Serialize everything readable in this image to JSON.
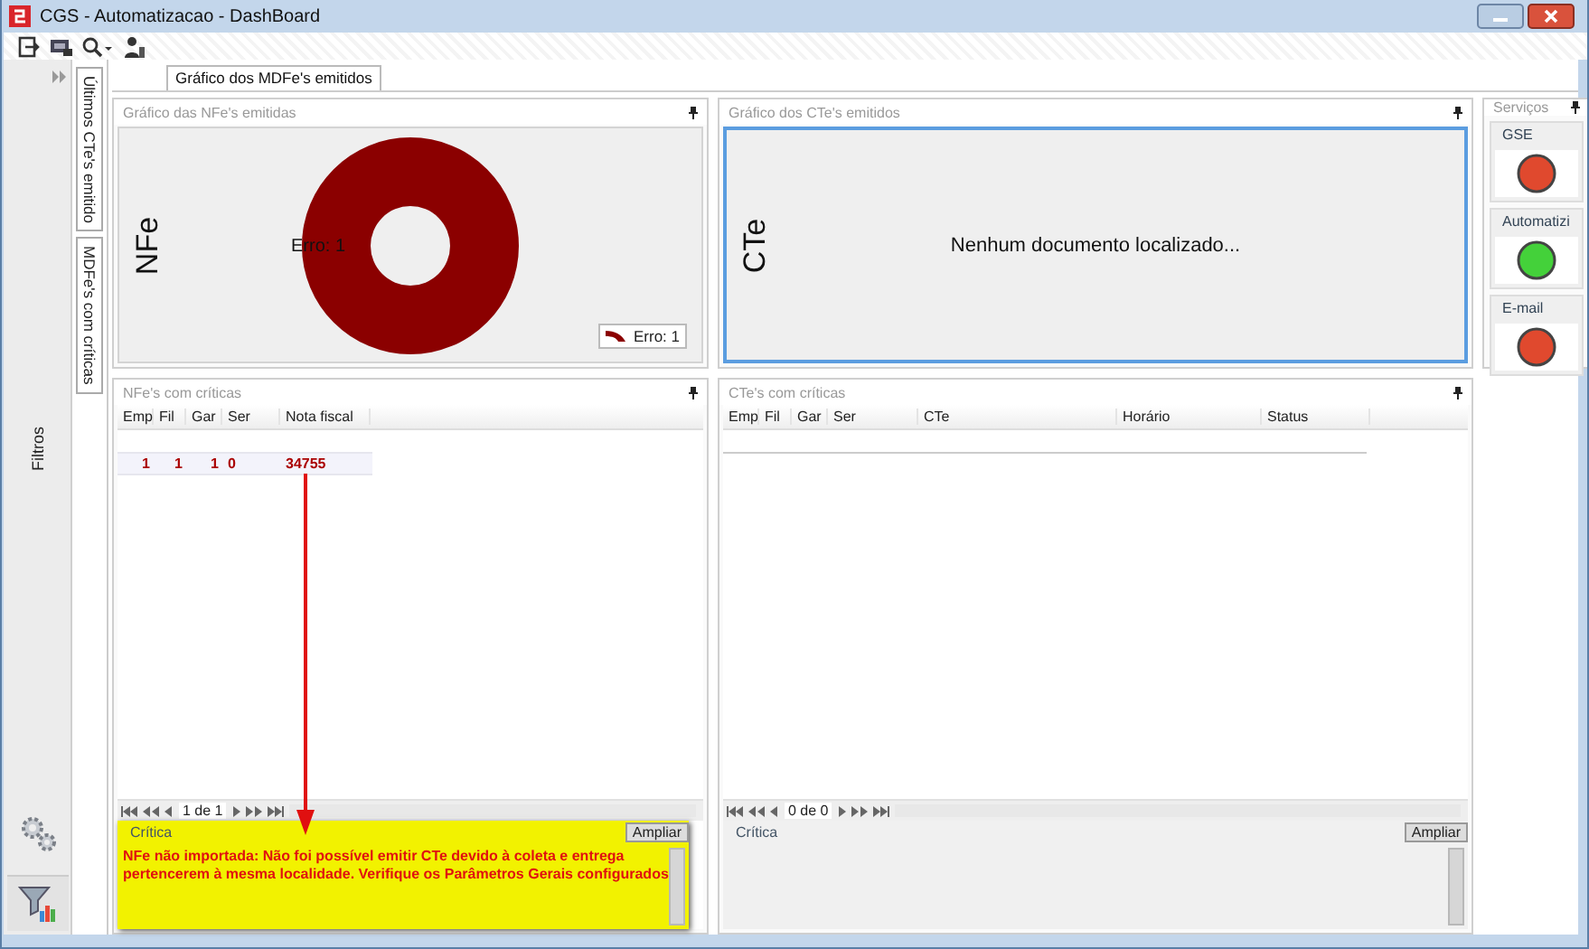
{
  "window": {
    "title": "CGS - Automatizacao - DashBoard"
  },
  "sidebar": {
    "label": "Filtros"
  },
  "side_tabs": [
    {
      "label": "Últimos CTe's emitido",
      "selected": false
    },
    {
      "label": "MDFe's com críticas",
      "selected": false
    }
  ],
  "top_tabs": [
    {
      "label": "Gráfico dos MDFe's emitidos",
      "selected": true
    }
  ],
  "nfe_chart_panel": {
    "title": "Gráfico das NFe's emitidas",
    "side_label": "NFe",
    "slice_label": "Erro: 1",
    "legend": [
      "Erro: 1"
    ]
  },
  "cte_chart_panel": {
    "title": "Gráfico dos CTe's emitidos",
    "side_label": "CTe",
    "message": "Nenhum documento localizado...",
    "focused": true
  },
  "services_panel": {
    "title": "Serviços",
    "items": [
      {
        "name": "GSE",
        "color": "#e0492e"
      },
      {
        "name": "Automatizi",
        "color": "#44d13a"
      },
      {
        "name": "E-mail",
        "color": "#e0492e"
      }
    ]
  },
  "nfe_table_panel": {
    "title": "NFe's com críticas",
    "columns": [
      "Emp",
      "Fil",
      "Gar",
      "Ser",
      "Nota fiscal"
    ],
    "rows": [
      [
        "1",
        "1",
        "1",
        "0",
        "34755"
      ]
    ],
    "pager": "1 de 1",
    "critica": {
      "label": "Crítica",
      "button": "Ampliar",
      "text": "NFe não importada: Não foi possível emitir CTe devido à coleta e entrega pertencerem à mesma localidade. Verifique os Parâmetros Gerais configurados",
      "highlighted": true
    },
    "arrow": true
  },
  "cte_table_panel": {
    "title": "CTe's com críticas",
    "columns": [
      "Emp",
      "Fil",
      "Gar",
      "Ser",
      "CTe",
      "Horário",
      "Status"
    ],
    "pager": "0 de 0",
    "critica": {
      "label": "Crítica",
      "button": "Ampliar",
      "highlighted": false
    },
    "arrow": false
  }
}
